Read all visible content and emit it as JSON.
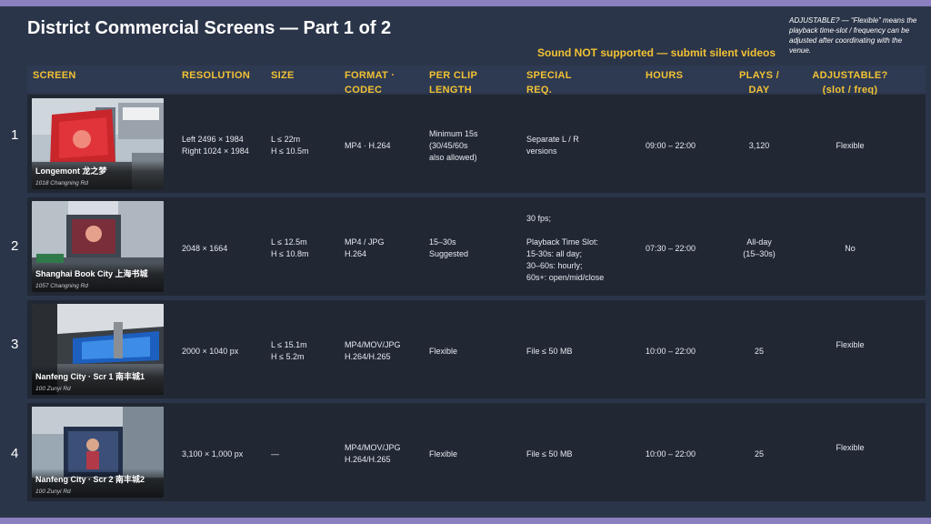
{
  "title": "District Commercial Screens — Part 1 of 2",
  "sound_notice": "Sound NOT supported — submit silent videos",
  "note": "ADJUSTABLE? — “Flexible” means the playback time-slot / frequency can be adjusted after coordinating with the venue.",
  "columns": {
    "screen": "SCREEN",
    "resolution": "RESOLUTION",
    "size": "SIZE",
    "format": "FORMAT ·\nCODEC",
    "clip_length": "PER CLIP\nLENGTH",
    "special": "SPECIAL\nREQ.",
    "hours": "HOURS",
    "plays": "PLAYS /\nDAY",
    "adjustable": "ADJUSTABLE?\n(slot / freq)"
  },
  "rows": [
    {
      "num": "1",
      "name": "Longemont 龙之梦",
      "address": "1018 Changning Rd",
      "resolution": "Left 2496 × 1984\nRight 1024 × 1984",
      "size": "L ≤ 22m\nH ≤ 10.5m",
      "format": "MP4 · H.264",
      "clip_length": "Minimum 15s\n(30/45/60s\nalso allowed)",
      "special": "Separate L / R\nversions",
      "hours": "09:00 – 22:00",
      "plays": "3,120",
      "adjustable": "Flexible"
    },
    {
      "num": "2",
      "name": "Shanghai Book City 上海书城",
      "address": "1057 Changning Rd",
      "resolution": "2048 × 1664",
      "size": "L ≤ 12.5m\nH ≤ 10.8m",
      "format": "MP4 / JPG\nH.264",
      "clip_length": "15–30s\nSuggested",
      "special": "30 fps;\n\nPlayback Time Slot:\n15-30s: all day;\n30–60s: hourly;\n60s+: open/mid/close",
      "hours": "07:30 – 22:00",
      "plays": "All-day\n(15–30s)",
      "adjustable": "No"
    },
    {
      "num": "3",
      "name": "Nanfeng City · Scr 1 南丰城1",
      "address": "100 Zunyi Rd",
      "resolution": "2000 × 1040 px",
      "size": "L ≤ 15.1m\nH ≤ 5.2m",
      "format": "MP4/MOV/JPG\nH.264/H.265",
      "clip_length": "Flexible",
      "special": "File ≤ 50 MB",
      "hours": "10:00 – 22:00",
      "plays": "25",
      "adjustable": "Flexible"
    },
    {
      "num": "4",
      "name": "Nanfeng City · Scr 2 南丰城2",
      "address": "100 Zunyi Rd",
      "resolution": "3,100 × 1,000 px",
      "size": "—",
      "format": "MP4/MOV/JPG\nH.264/H.265",
      "clip_length": "Flexible",
      "special": "File ≤ 50 MB",
      "hours": "10:00 – 22:00",
      "plays": "25",
      "adjustable": "Flexible"
    }
  ],
  "colors": {
    "background": "#2b3549",
    "row": "#212834",
    "accent": "#f2c233",
    "frame": "#8b7fbf"
  }
}
